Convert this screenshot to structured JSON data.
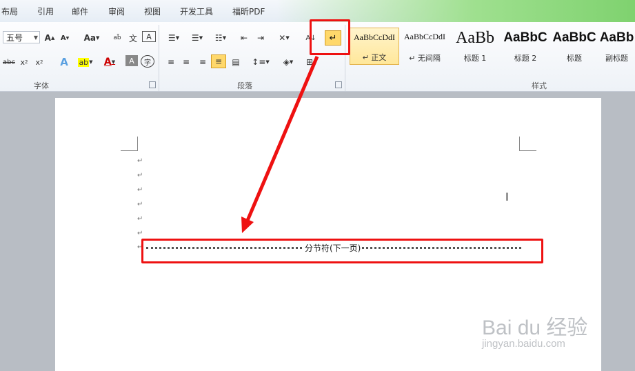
{
  "menu": {
    "items": [
      "布局",
      "引用",
      "邮件",
      "审阅",
      "视图",
      "开发工具",
      "福昕PDF"
    ]
  },
  "ribbon": {
    "font_size_value": "五号",
    "font_group_label": "字体",
    "paragraph_group_label": "段落",
    "styles_group_label": "样式",
    "aa_label": "Aa",
    "strike_label": "abc",
    "styles": [
      {
        "sample": "AaBbCcDdI",
        "name": "↵ 正文"
      },
      {
        "sample": "AaBbCcDdI",
        "name": "↵ 无间隔"
      },
      {
        "sample": "AaBb",
        "name": "标题 1"
      },
      {
        "sample": "AaBbC",
        "name": "标题 2"
      },
      {
        "sample": "AaBbC",
        "name": "标题"
      },
      {
        "sample": "AaBb",
        "name": "副标题"
      }
    ]
  },
  "document": {
    "paragraph_mark": "↵",
    "section_break_label": "分节符(下一页)"
  },
  "watermark": {
    "title": "Bai du 经验",
    "subtitle": "jingyan.baidu.com"
  },
  "colors": {
    "highlight_red": "#ee1111",
    "accent_yellow": "#ffd86b"
  }
}
